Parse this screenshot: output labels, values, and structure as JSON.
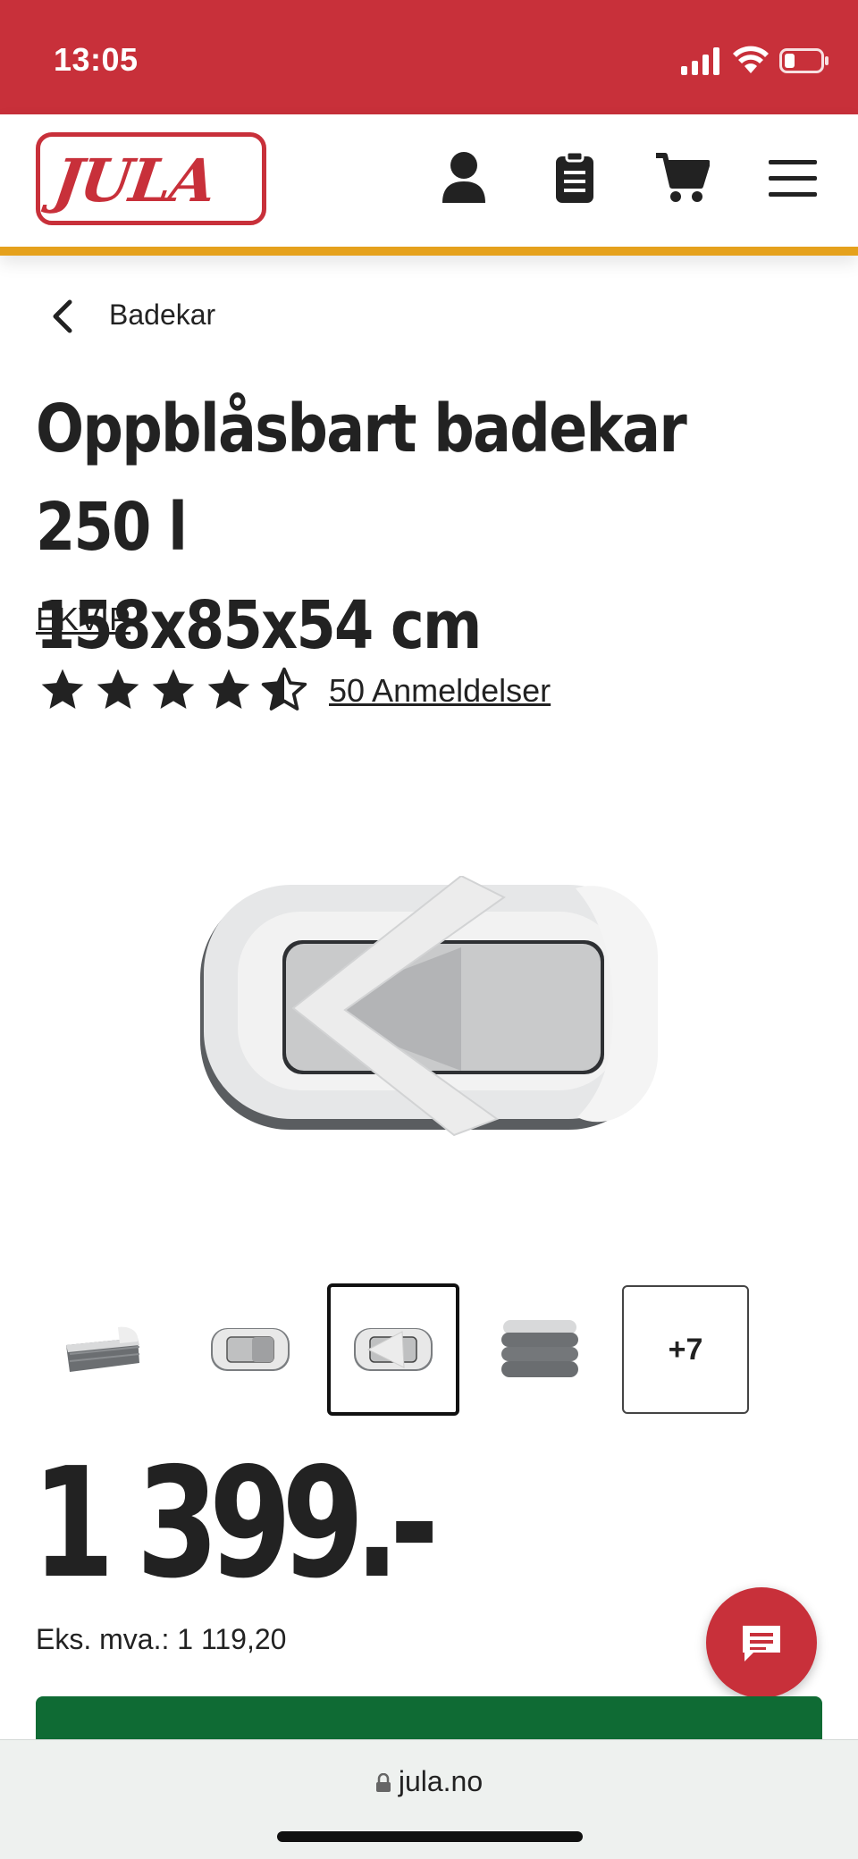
{
  "status_bar": {
    "time": "13:05"
  },
  "header": {
    "logo_text": "JULA",
    "icons": [
      "account-icon",
      "list-icon",
      "cart-icon",
      "menu-icon"
    ]
  },
  "breadcrumb": {
    "label": "Badekar"
  },
  "product": {
    "title_line1": "Oppblåsbart badekar 250 l",
    "title_line2": "158x85x54 cm",
    "brand": "EKVIP",
    "rating": 4.5,
    "rating_max": 5,
    "reviews_label": "50 Anmeldelser",
    "more_images_label": "+7",
    "price": "1 399.-",
    "ex_vat": "Eks. mva.: 1 119,20"
  },
  "browser": {
    "url": "jula.no"
  },
  "colors": {
    "brand_red": "#c8303a",
    "accent_yellow": "#e5a11c",
    "buy_green": "#0f6b34"
  }
}
